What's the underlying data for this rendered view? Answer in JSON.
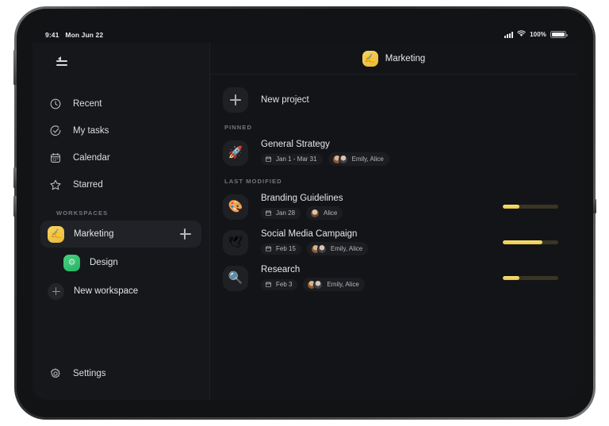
{
  "status_bar": {
    "time": "9:41",
    "date": "Mon Jun 22",
    "battery_percent": "100%",
    "signal_icon": "cellular-signal-icon",
    "wifi_icon": "wifi-icon",
    "battery_icon": "battery-icon"
  },
  "sidebar": {
    "collapse_icon": "collapse-sidebar-icon",
    "nav_items": [
      {
        "label": "Recent",
        "icon": "clock-icon"
      },
      {
        "label": "My tasks",
        "icon": "check-circle-icon"
      },
      {
        "label": "Calendar",
        "icon": "calendar-icon"
      },
      {
        "label": "Starred",
        "icon": "star-icon"
      }
    ],
    "workspaces_label": "WORKSPACES",
    "workspaces": [
      {
        "label": "Marketing",
        "emoji": "✍",
        "color": "#f0c84a",
        "selected": true,
        "indent": false,
        "add_icon": "plus-icon"
      },
      {
        "label": "Design",
        "emoji": "⚙",
        "color": "#2fbf6c",
        "selected": false,
        "indent": true
      }
    ],
    "new_workspace": {
      "label": "New workspace",
      "icon": "plus-circle-icon"
    },
    "settings": {
      "label": "Settings",
      "icon": "gear-icon"
    }
  },
  "main": {
    "header": {
      "title": "Marketing",
      "emoji": "✍",
      "avatar_color": "#f0c84a"
    },
    "new_project": {
      "label": "New project",
      "icon": "plus-icon"
    },
    "sections": [
      {
        "label": "PINNED",
        "projects": [
          {
            "title": "General Strategy",
            "emoji": "🚀",
            "date": "Jan 1 - Mar 31",
            "date_icon": "calendar-icon",
            "members": "Emily, Alice",
            "avatars": [
              "emily",
              "alice"
            ],
            "has_progress": false,
            "progress": null
          }
        ]
      },
      {
        "label": "LAST MODIFIED",
        "projects": [
          {
            "title": "Branding Guidelines",
            "emoji": "🎨",
            "date": "Jan 28",
            "date_icon": "calendar-icon",
            "members": "Alice",
            "avatars": [
              "alice-solo"
            ],
            "has_progress": true,
            "progress": 30
          },
          {
            "title": "Social Media Campaign",
            "emoji": "🕊",
            "date": "Feb 15",
            "date_icon": "calendar-icon",
            "members": "Emily, Alice",
            "avatars": [
              "emily",
              "alice"
            ],
            "has_progress": true,
            "progress": 72
          },
          {
            "title": "Research",
            "emoji": "🔍",
            "date": "Feb 3",
            "date_icon": "calendar-icon",
            "members": "Emily, Alice",
            "avatars": [
              "emily",
              "alice"
            ],
            "has_progress": true,
            "progress": 30
          }
        ]
      }
    ]
  },
  "theme": {
    "accent": "#ecc840",
    "background": "#131417",
    "sidebar_background": "#16171a",
    "text_primary": "#e4e6ea",
    "text_secondary": "#74767c"
  }
}
